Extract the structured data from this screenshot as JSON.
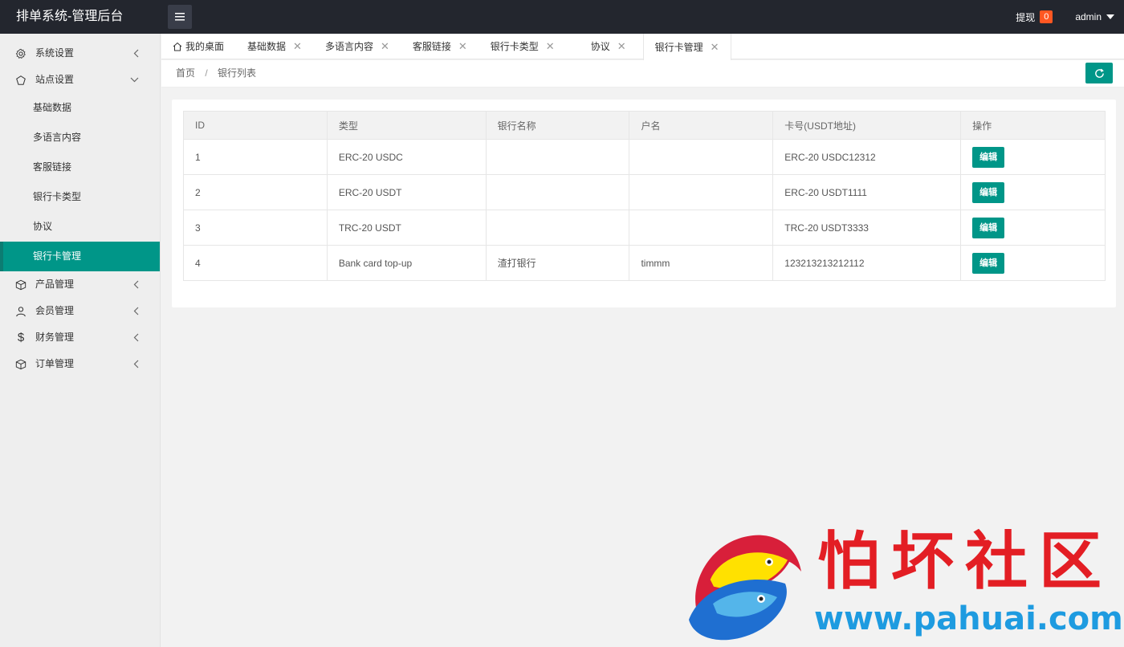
{
  "app": {
    "title": "排单系统-管理后台"
  },
  "header": {
    "withdraw_label": "提现",
    "withdraw_count": "0",
    "user_name": "admin"
  },
  "sidebar": {
    "groups": [
      {
        "label": "系统设置",
        "icon": "gear-icon"
      },
      {
        "label": "站点设置",
        "icon": "site-icon"
      },
      {
        "label": "产品管理",
        "icon": "box-icon"
      },
      {
        "label": "会员管理",
        "icon": "user-icon"
      },
      {
        "label": "财务管理",
        "icon": "dollar-icon"
      },
      {
        "label": "订单管理",
        "icon": "order-icon"
      }
    ],
    "site_children": [
      "基础数据",
      "多语言内容",
      "客服链接",
      "银行卡类型",
      "协议",
      "银行卡管理"
    ]
  },
  "tabs": [
    {
      "label": "我的桌面"
    },
    {
      "label": "基础数据"
    },
    {
      "label": "多语言内容"
    },
    {
      "label": "客服链接"
    },
    {
      "label": "银行卡类型"
    },
    {
      "label": "协议"
    },
    {
      "label": "银行卡管理"
    }
  ],
  "breadcrumb": {
    "home": "首页",
    "sep": "/",
    "current": "银行列表"
  },
  "table": {
    "headers": [
      "ID",
      "类型",
      "银行名称",
      "户名",
      "卡号(USDT地址)",
      "操作"
    ],
    "rows": [
      {
        "id": "1",
        "type": "ERC-20 USDC",
        "bank": "",
        "holder": "",
        "card": "ERC-20 USDC12312",
        "action": "编辑"
      },
      {
        "id": "2",
        "type": "ERC-20 USDT",
        "bank": "",
        "holder": "",
        "card": "ERC-20 USDT1111",
        "action": "编辑"
      },
      {
        "id": "3",
        "type": "TRC-20 USDT",
        "bank": "",
        "holder": "",
        "card": "TRC-20 USDT3333",
        "action": "编辑"
      },
      {
        "id": "4",
        "type": "Bank card top-up",
        "bank": "渣打银行",
        "holder": "timmm",
        "card": "123213213212112",
        "action": "编辑"
      }
    ]
  },
  "watermark": {
    "text": "怕坏社区",
    "url": "www.pahuai.com"
  },
  "colors": {
    "header_bg": "#23262e",
    "accent": "#009688",
    "badge": "#ff5722"
  }
}
